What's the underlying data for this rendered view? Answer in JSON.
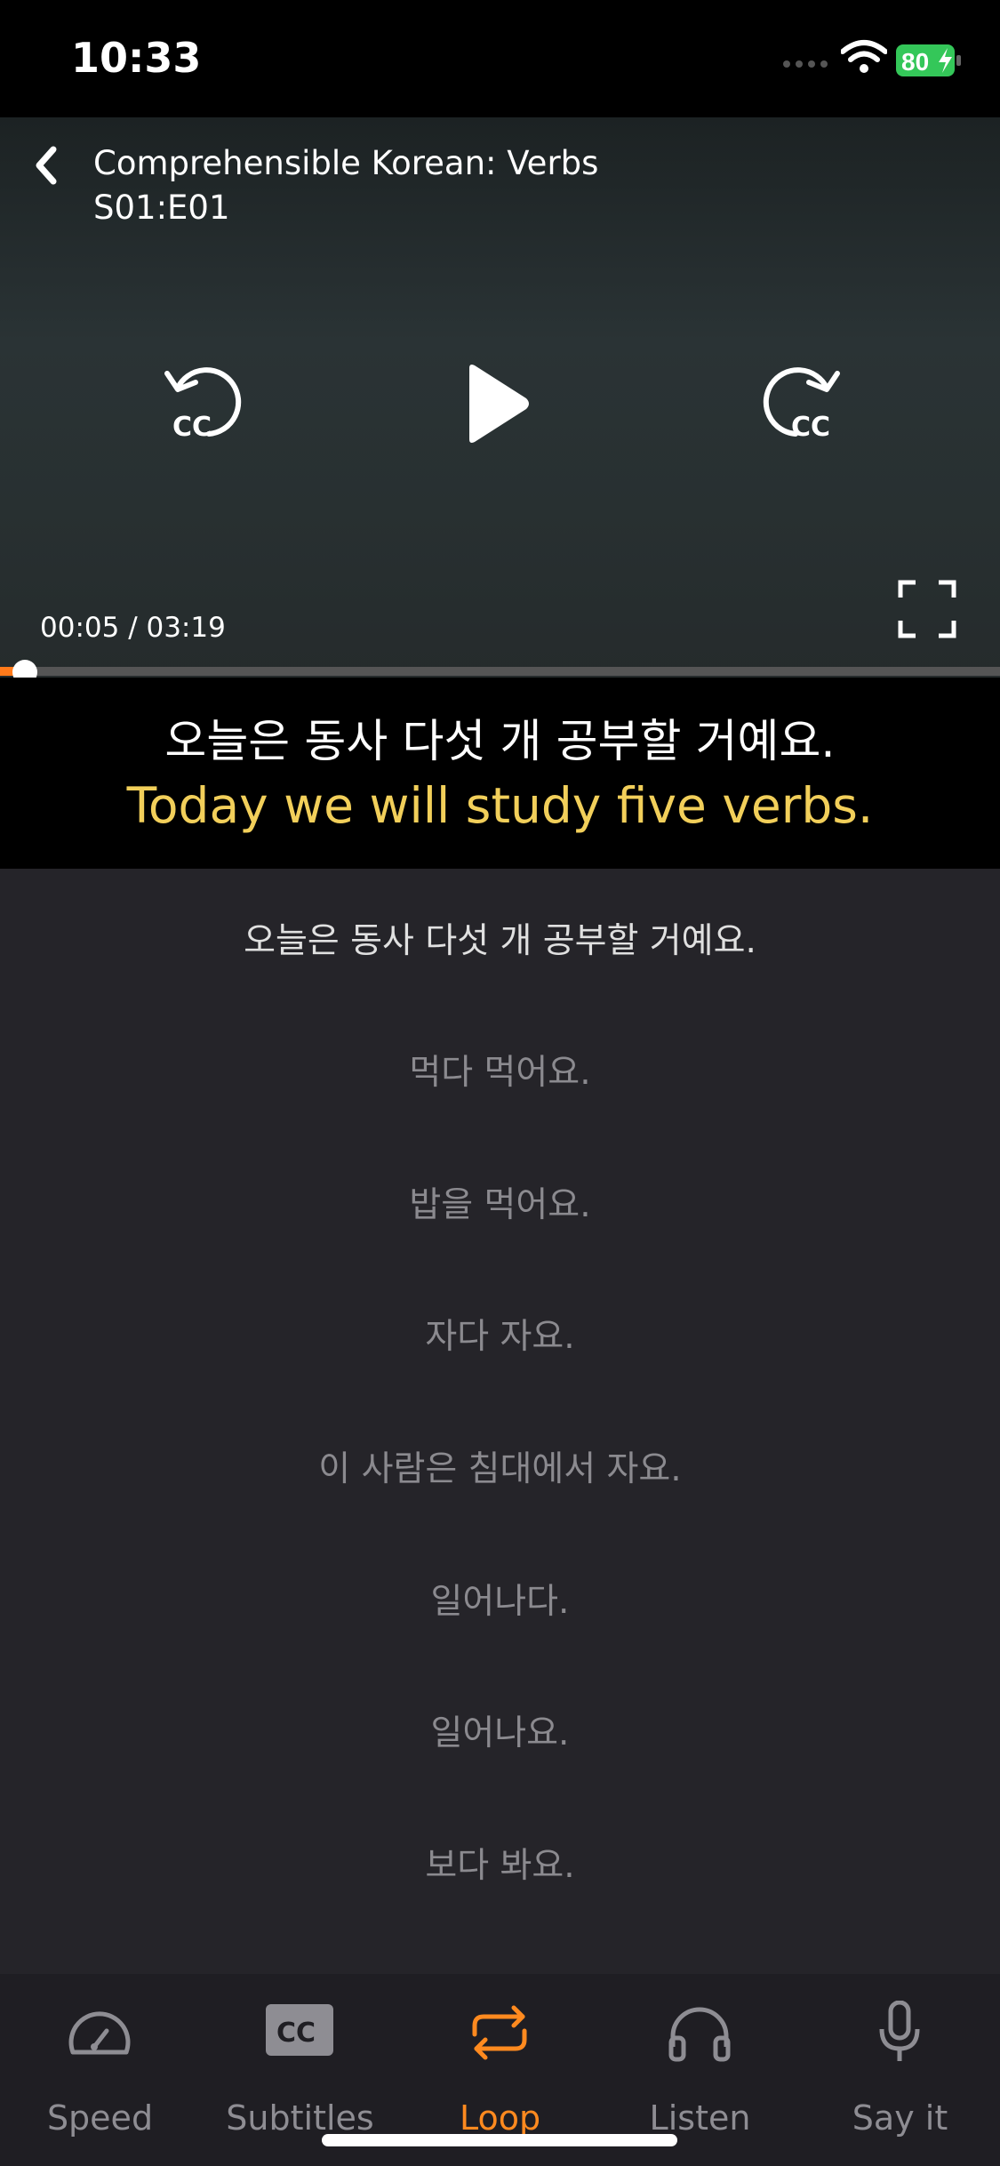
{
  "status_bar": {
    "time": "10:33",
    "battery": "80"
  },
  "player": {
    "title": "Comprehensible Korean: Verbs",
    "episode": "S01:E01",
    "current_time": "00:05 / 03:19",
    "progress": 0.025,
    "subtitle_korean": "오늘은 동사 다섯 개 공부할 거예요.",
    "subtitle_english": "Today we will study five verbs."
  },
  "transcript": [
    "오늘은 동사 다섯 개 공부할 거예요.",
    "먹다 먹어요.",
    "밥을 먹어요.",
    "자다 자요.",
    "이 사람은 침대에서 자요.",
    "일어나다.",
    "일어나요.",
    "보다 봐요."
  ],
  "tabs": [
    {
      "label": "Speed",
      "icon": "speedometer-icon"
    },
    {
      "label": "Subtitles",
      "icon": "cc-icon"
    },
    {
      "label": "Loop",
      "icon": "loop-icon",
      "active": true
    },
    {
      "label": "Listen",
      "icon": "headphones-icon"
    },
    {
      "label": "Say it",
      "icon": "microphone-icon"
    }
  ],
  "colors": {
    "accent": "#ff8a1f",
    "subtitle_english": "#f2cf5a",
    "battery_green": "#34c759"
  }
}
